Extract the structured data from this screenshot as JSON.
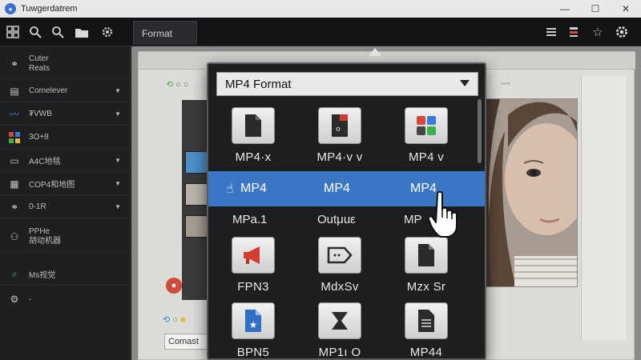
{
  "window": {
    "title": "Tuwgerdatrem",
    "controls": [
      "—",
      "☐",
      "✕"
    ]
  },
  "toolbar": {
    "left_icons": [
      "grid-icon",
      "search-icon",
      "zoom-icon",
      "folder-icon",
      "gear-icon"
    ],
    "right_icons": [
      "list-icon",
      "layers-icon",
      "star-icon",
      "gear-icon"
    ],
    "tab_label": "Format"
  },
  "sidebar": {
    "items": [
      {
        "label": "Cuter",
        "label2": "Reats",
        "icon": "link-icon",
        "chevron": false
      },
      {
        "label": "Comelever",
        "icon": "film-icon",
        "chevron": true
      },
      {
        "label": "₮VWB",
        "icon": "wave-icon",
        "chevron": true
      },
      {
        "label": "3O+8",
        "icon": "apps-icon",
        "chevron": false
      },
      {
        "label": "A4C地毯",
        "icon": "monitor-icon",
        "chevron": true
      },
      {
        "label": "COP4和地图",
        "icon": "layout-icon",
        "chevron": true
      },
      {
        "label": "0-1R",
        "icon": "link-icon",
        "chevron": true
      },
      {
        "label": "PPHe",
        "label2": "胡动机器",
        "icon": "people-icon",
        "chevron": false
      },
      {
        "label": "Ms视觉",
        "icon": "search-icon",
        "chevron": false
      },
      {
        "label": "-",
        "icon": "gear-icon",
        "chevron": false
      }
    ]
  },
  "background": {
    "bottom_field": "Comast"
  },
  "popup": {
    "select_value": "MP4 Format",
    "grid_top": [
      {
        "label": "MP4·x",
        "icon": "document-icon"
      },
      {
        "label": "MP4·v v",
        "icon": "document-red-icon"
      },
      {
        "label": "MP4 v",
        "icon": "apps-icon"
      }
    ],
    "highlight_row": [
      "MP4",
      "MP4",
      "MP4"
    ],
    "sub_row": [
      "MPa.1",
      "Outμuε",
      "MP"
    ],
    "grid_mid": [
      {
        "label": "FPN3",
        "icon": "megaphone-icon"
      },
      {
        "label": "MdxSv",
        "icon": "tag-icon"
      },
      {
        "label": "Mzx Sr",
        "icon": "document-icon"
      }
    ],
    "grid_bottom": [
      {
        "label": "BPN5",
        "icon": "star-document-icon"
      },
      {
        "label": "MP1ı O",
        "icon": "hourglass-icon"
      },
      {
        "label": "MP44",
        "icon": "lines-document-icon"
      }
    ]
  },
  "colors": {
    "highlight": "#3a76c4",
    "panel": "#1d1e20",
    "accent_red": "#d23b2e"
  }
}
